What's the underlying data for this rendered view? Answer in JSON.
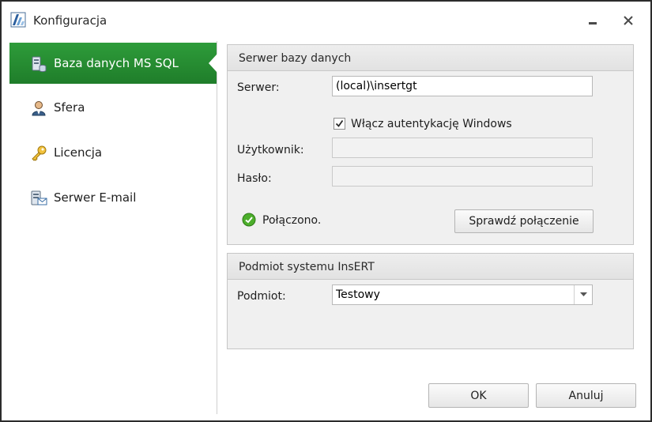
{
  "window": {
    "title": "Konfiguracja",
    "icons": {
      "app": "insert-logo-icon",
      "minimize": "minimize-icon",
      "close": "close-icon"
    }
  },
  "sidebar": {
    "items": [
      {
        "label": "Baza danych MS SQL",
        "icon": "database-server-icon",
        "active": true
      },
      {
        "label": "Sfera",
        "icon": "user-icon",
        "active": false
      },
      {
        "label": "Licencja",
        "icon": "key-icon",
        "active": false
      },
      {
        "label": "Serwer E-mail",
        "icon": "email-server-icon",
        "active": false
      }
    ]
  },
  "db_group": {
    "title": "Serwer bazy danych",
    "server_label": "Serwer:",
    "server_value": "(local)\\insertgt",
    "windows_auth_label": "Włącz autentykację Windows",
    "windows_auth_checked": true,
    "user_label": "Użytkownik:",
    "user_value": "",
    "password_label": "Hasło:",
    "password_value": "",
    "status_text": "Połączono.",
    "status_icon": "success-check-icon",
    "test_button": "Sprawdź połączenie"
  },
  "entity_group": {
    "title": "Podmiot systemu InsERT",
    "entity_label": "Podmiot:",
    "entity_value": "Testowy"
  },
  "footer": {
    "ok": "OK",
    "cancel": "Anuluj"
  },
  "colors": {
    "accent": "#1f7d2a",
    "success": "#4cae2b"
  }
}
